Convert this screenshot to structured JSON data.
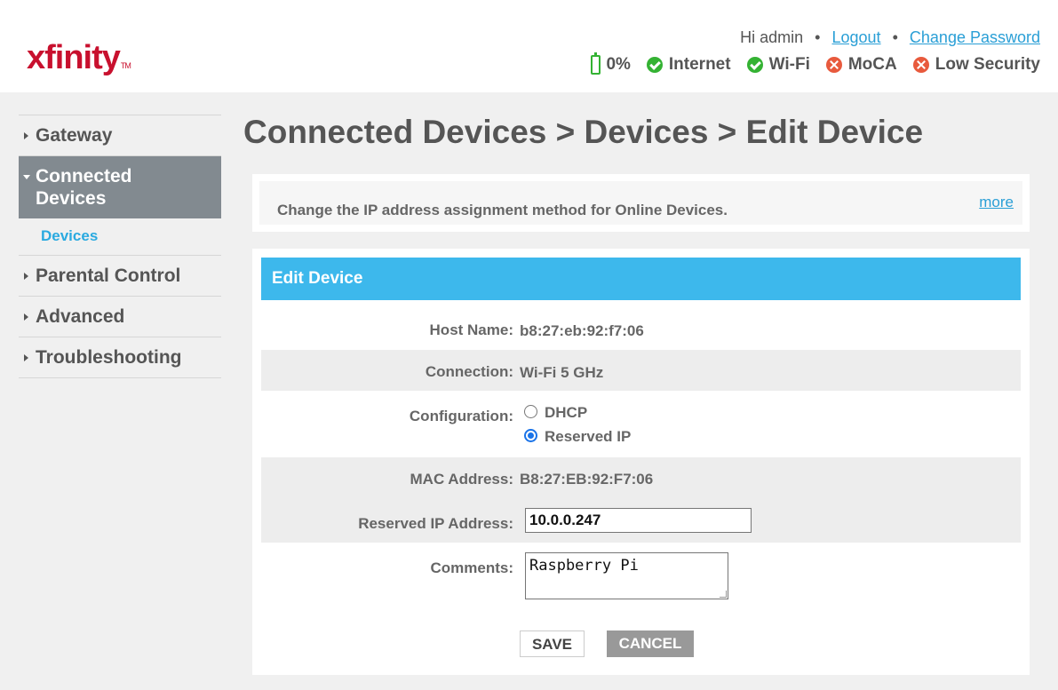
{
  "brand": {
    "logo_text": "xfinity",
    "trademark": "TM"
  },
  "header": {
    "greeting": "Hi admin",
    "separator": "•",
    "logout_label": "Logout",
    "change_password_label": "Change Password",
    "status": {
      "battery": "0%",
      "internet": "Internet",
      "wifi": "Wi-Fi",
      "moca": "MoCA",
      "security": "Low Security"
    }
  },
  "sidebar": {
    "items": [
      {
        "label": "Gateway"
      },
      {
        "label": "Connected Devices"
      },
      {
        "label": "Parental Control"
      },
      {
        "label": "Advanced"
      },
      {
        "label": "Troubleshooting"
      }
    ],
    "subitem": "Devices"
  },
  "page": {
    "title": "Connected Devices > Devices > Edit Device",
    "info_text": "Change the IP address assignment method for Online Devices.",
    "more_label": "more"
  },
  "form": {
    "header": "Edit Device",
    "host_name_label": "Host Name:",
    "host_name_value": "b8:27:eb:92:f7:06",
    "connection_label": "Connection:",
    "connection_value": "Wi-Fi 5 GHz",
    "configuration_label": "Configuration:",
    "config_option_dhcp": "DHCP",
    "config_option_reserved": "Reserved IP",
    "mac_label": "MAC Address:",
    "mac_value": "B8:27:EB:92:F7:06",
    "reserved_ip_label": "Reserved IP Address:",
    "reserved_ip_value": "10.0.0.247",
    "comments_label": "Comments:",
    "comments_value": "Raspberry Pi",
    "save_label": "SAVE",
    "cancel_label": "CANCEL"
  },
  "colors": {
    "brand_red": "#c8102e",
    "accent_blue": "#3db8ec",
    "ok_green": "#34b233",
    "error_red": "#e85a3d",
    "active_nav": "#828a90"
  }
}
